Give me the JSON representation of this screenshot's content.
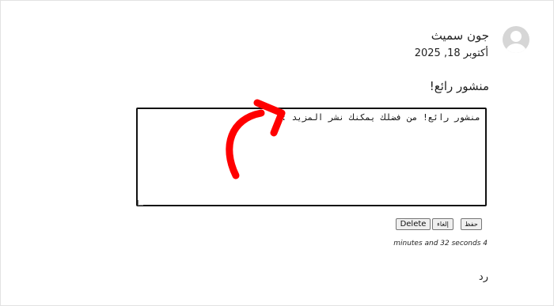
{
  "comment": {
    "author": "جون سميث",
    "date": "أكتوبر 18, 2025",
    "text": "منشور رائع!",
    "edit_value": "منشور رائع! من فضلك يمكنك نشر المزيد :)"
  },
  "actions": {
    "save_label": "حفظ",
    "cancel_label": "إلغاء",
    "delete_label": "Delete"
  },
  "elapsed_time": "minutes and 32 seconds 4",
  "reply_label": "رد",
  "colors": {
    "arrow": "#ff0000",
    "avatar_bg": "#d6d6d6",
    "editor_border": "#111111"
  },
  "icons": {
    "avatar": "default-user-silhouette",
    "annotation": "curved-red-arrow"
  }
}
